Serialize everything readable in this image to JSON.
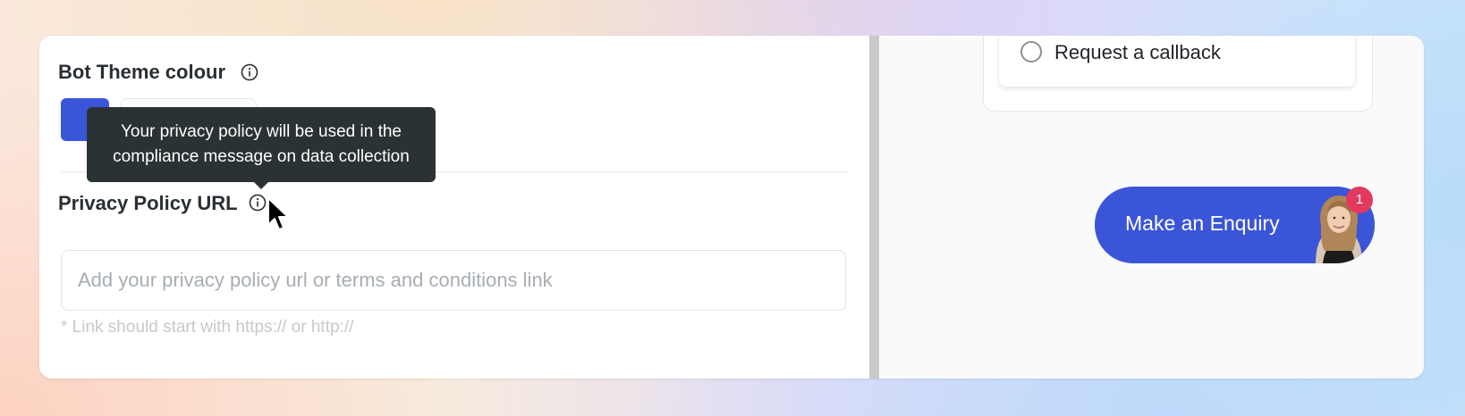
{
  "settings": {
    "bot_theme": {
      "title": "Bot Theme colour",
      "swatch_color": "#3b55d9",
      "info_icon": "info-icon"
    },
    "privacy_policy": {
      "title": "Privacy Policy URL",
      "info_icon": "info-icon",
      "input_placeholder": "Add your privacy policy url or terms and conditions link",
      "input_value": "",
      "hint": "* Link should start with https:// or http://"
    },
    "tooltip": {
      "line1": "Your privacy policy will be used in the",
      "line2": "compliance message on data collection"
    }
  },
  "preview": {
    "option_label": "Request a callback",
    "cta_label": "Make an Enquiry",
    "cta_color": "#3b55d9",
    "badge_count": "1",
    "badge_color": "#e23a5e"
  }
}
